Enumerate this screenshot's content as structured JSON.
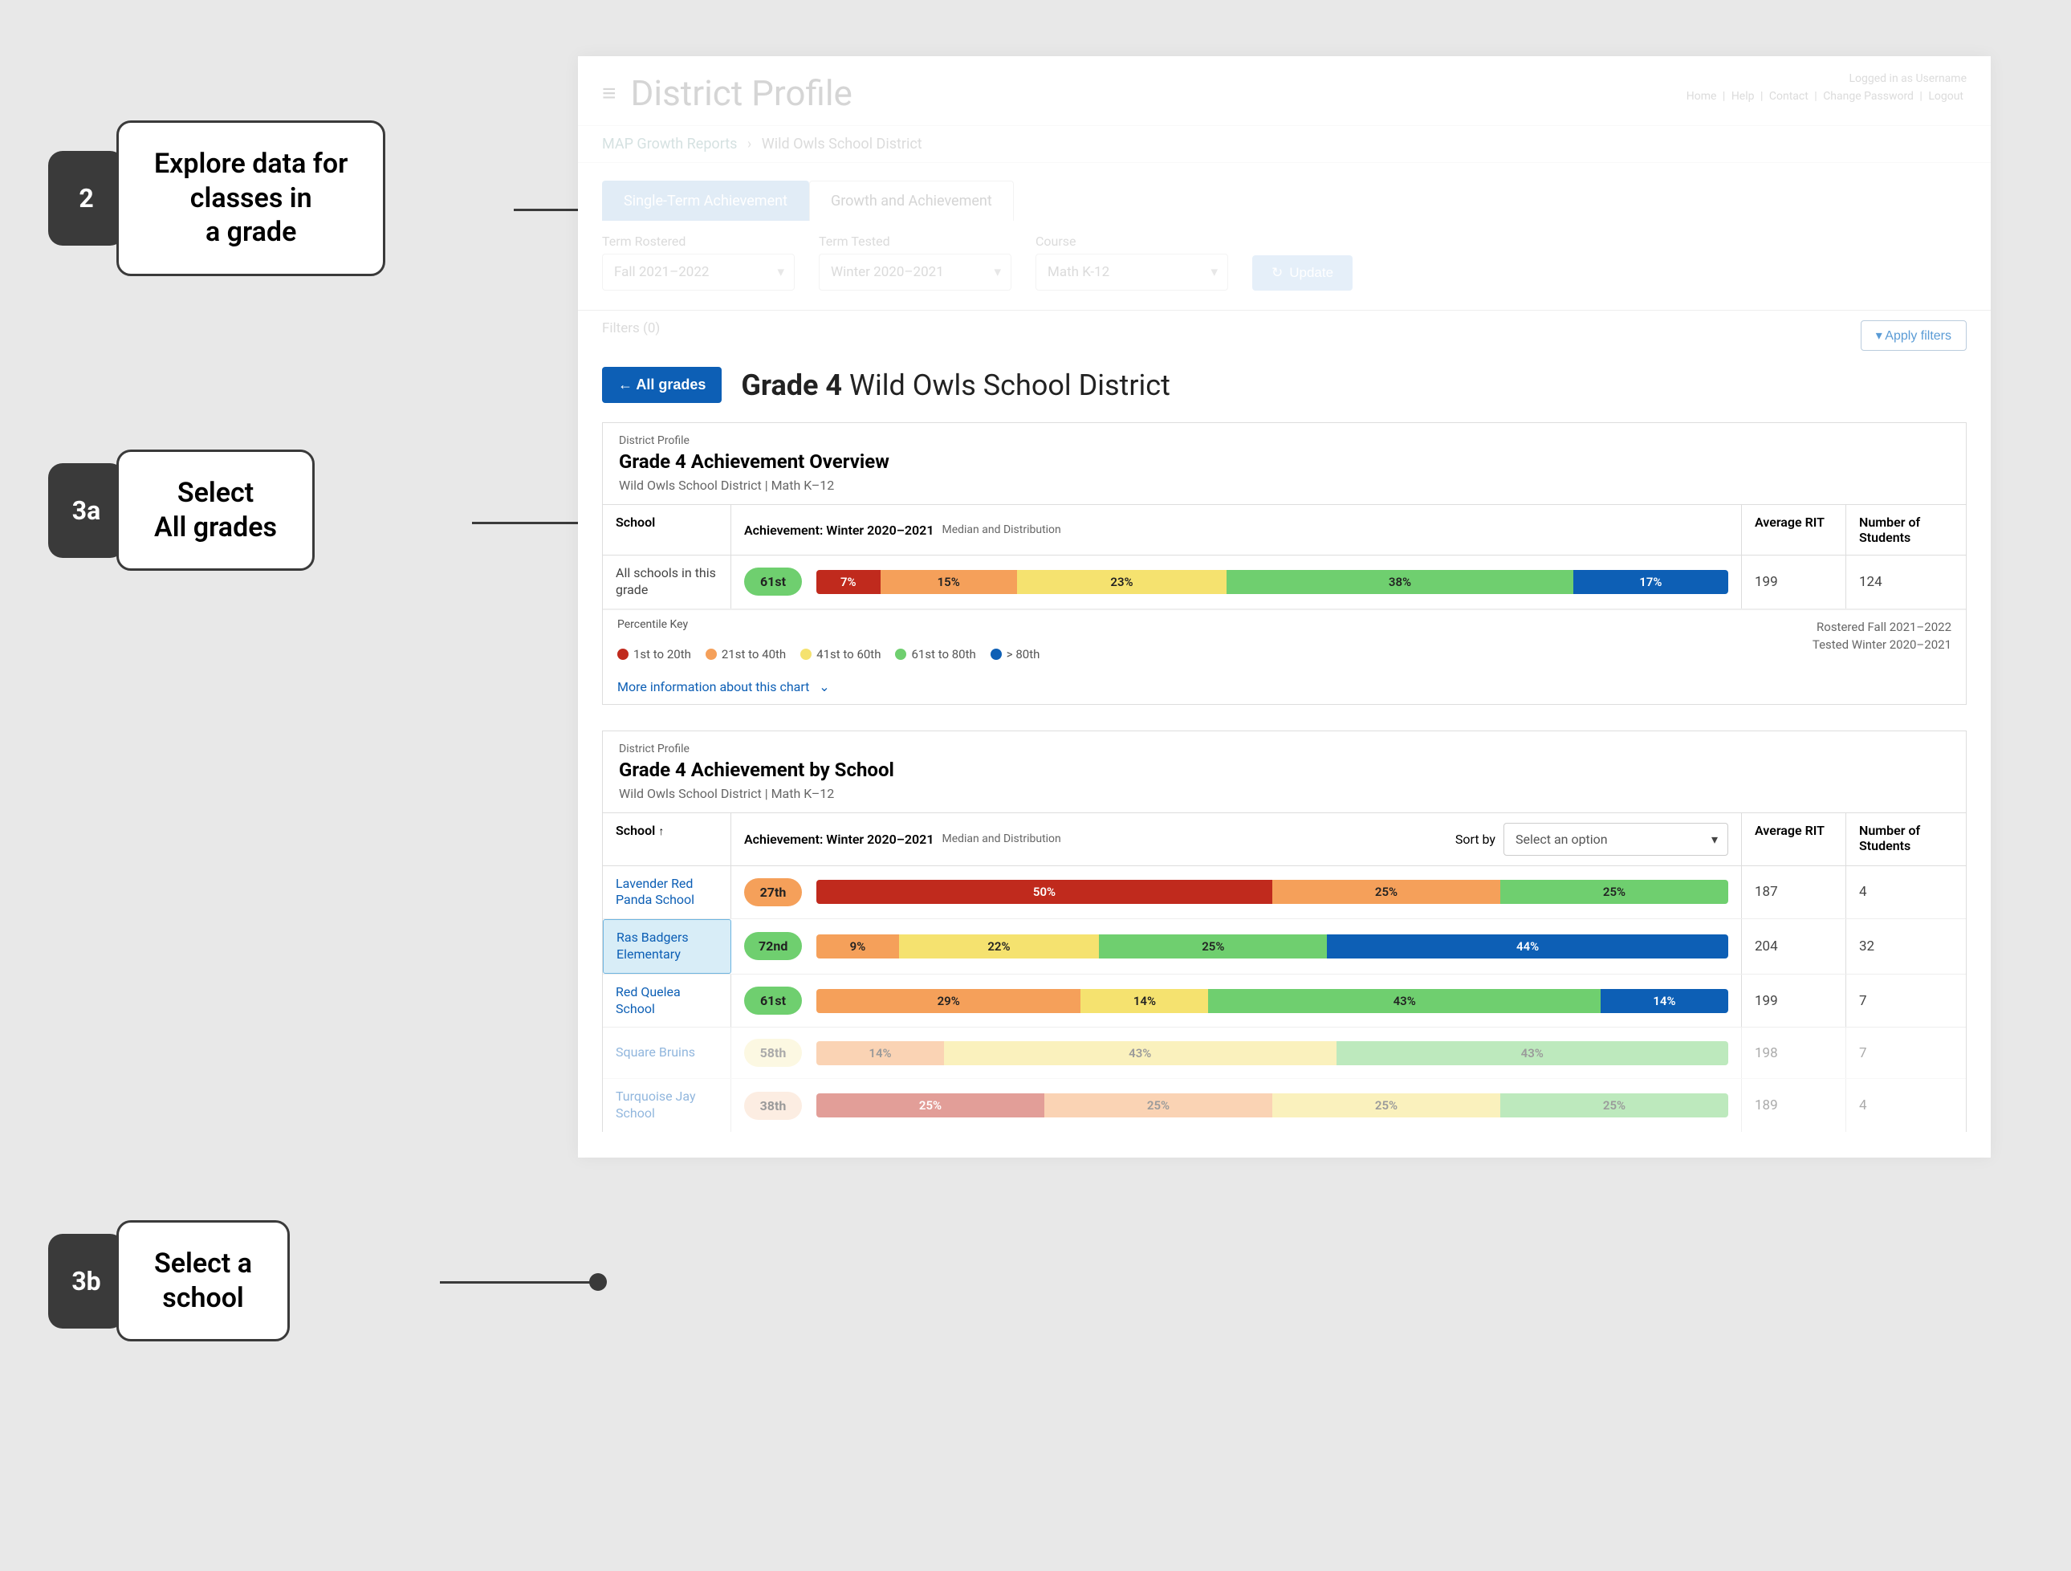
{
  "callouts": {
    "c2": {
      "badge": "2",
      "text": "Explore data for\nclasses in\na grade"
    },
    "c3a": {
      "badge": "3a",
      "text": "Select\nAll grades"
    },
    "c3b": {
      "badge": "3b",
      "text": "Select a\nschool"
    }
  },
  "header": {
    "title": "District Profile",
    "logged_in": "Logged in as Username",
    "links": [
      "Home",
      "Help",
      "Contact",
      "Change Password",
      "Logout"
    ]
  },
  "breadcrumb": {
    "link": "MAP Growth Reports",
    "current": "Wild Owls School District"
  },
  "tabs": {
    "active": "Single-Term Achievement",
    "other": "Growth and Achievement"
  },
  "filters": {
    "term_rostered_label": "Term Rostered",
    "term_rostered_value": "Fall 2021–2022",
    "term_tested_label": "Term Tested",
    "term_tested_value": "Winter 2020–2021",
    "course_label": "Course",
    "course_value": "Math K-12",
    "update": "Update",
    "filters_label": "Filters",
    "filters_count": "(0)",
    "apply": "Apply filters"
  },
  "gradeHeader": {
    "all_grades": "All grades",
    "title_bold": "Grade 4",
    "title_rest": "Wild Owls School District"
  },
  "overview": {
    "eyebrow": "District Profile",
    "title": "Grade 4 Achievement Overview",
    "sub": "Wild Owls School District  |  Math K–12",
    "col_school": "School",
    "col_achieve_bold": "Achievement: Winter 2020–2021",
    "col_achieve_light": "Median and Distribution",
    "col_rit": "Average RIT",
    "col_num": "Number of Students",
    "row_label": "All schools in this grade",
    "pill": "61st",
    "rit": "199",
    "num": "124",
    "pkey_title": "Percentile Key",
    "pkey_items": [
      "1st to 20th",
      "21st to 40th",
      "41st to 60th",
      "61st to 80th",
      "> 80th"
    ],
    "rostered": "Rostered Fall 2021–2022",
    "tested": "Tested Winter 2020–2021",
    "more_info": "More information about this chart"
  },
  "bySchool": {
    "eyebrow": "District Profile",
    "title": "Grade 4 Achievement by School",
    "sub": "Wild Owls School District  |  Math K–12",
    "col_school": "School",
    "col_achieve_bold": "Achievement: Winter 2020–2021",
    "col_achieve_light": "Median and Distribution",
    "sort_by": "Sort by",
    "sort_placeholder": "Select an option",
    "col_rit": "Average RIT",
    "col_num": "Number of Students",
    "rows": {
      "r0": {
        "name": "Lavender Red Panda School",
        "pill": "27th",
        "rit": "187",
        "num": "4"
      },
      "r1": {
        "name": "Ras Badgers Elementary",
        "pill": "72nd",
        "rit": "204",
        "num": "32"
      },
      "r2": {
        "name": "Red Quelea School",
        "pill": "61st",
        "rit": "199",
        "num": "7"
      },
      "r3": {
        "name": "Square Bruins",
        "pill": "58th",
        "rit": "198",
        "num": "7"
      },
      "r4": {
        "name": "Turquoise Jay School",
        "pill": "38th",
        "rit": "189",
        "num": "4"
      }
    }
  },
  "chart_data": [
    {
      "type": "bar",
      "title": "Grade 4 Achievement Overview — All schools in this grade",
      "categories": [
        "1st–20th",
        "21st–40th",
        "41st–60th",
        "61st–80th",
        ">80th"
      ],
      "values": [
        7,
        15,
        23,
        38,
        17
      ],
      "median_percentile": "61st",
      "average_rit": 199,
      "n_students": 124
    },
    {
      "type": "bar",
      "title": "Grade 4 Achievement by School — percentile distribution",
      "categories": [
        "1st–20th",
        "21st–40th",
        "41st–60th",
        "61st–80th",
        ">80th"
      ],
      "series": [
        {
          "name": "Lavender Red Panda School",
          "values": [
            50,
            25,
            0,
            25,
            0
          ],
          "median": "27th",
          "rit": 187,
          "n": 4
        },
        {
          "name": "Ras Badgers Elementary",
          "values": [
            0,
            9,
            22,
            25,
            44
          ],
          "median": "72nd",
          "rit": 204,
          "n": 32
        },
        {
          "name": "Red Quelea School",
          "values": [
            0,
            29,
            14,
            43,
            14
          ],
          "median": "61st",
          "rit": 199,
          "n": 7
        },
        {
          "name": "Square Bruins",
          "values": [
            0,
            14,
            43,
            43,
            0
          ],
          "median": "58th",
          "rit": 198,
          "n": 7
        },
        {
          "name": "Turquoise Jay School",
          "values": [
            25,
            25,
            25,
            25,
            0
          ],
          "median": "38th",
          "rit": 189,
          "n": 4
        }
      ]
    }
  ]
}
